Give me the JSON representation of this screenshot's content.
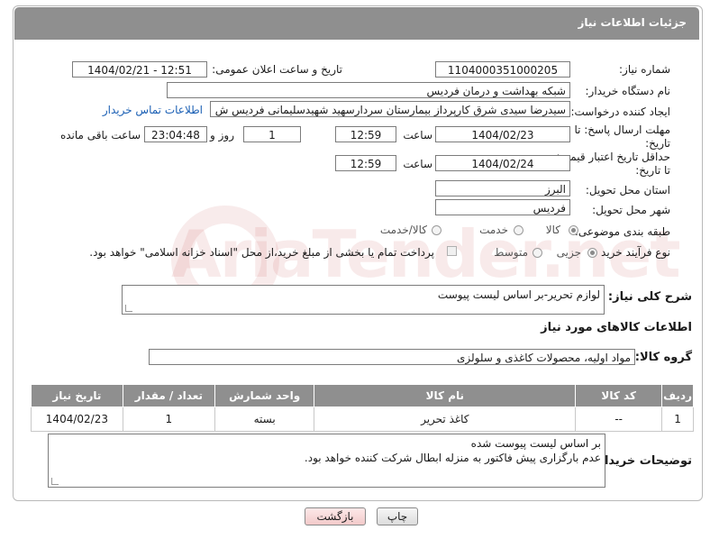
{
  "header": {
    "title": "جزئیات اطلاعات نیاز"
  },
  "form": {
    "need_number_label": "شماره نیاز:",
    "need_number": "1104000351000205",
    "announce_label": "تاریخ و ساعت اعلان عمومی:",
    "announce_value": "1404/02/21 - 12:51",
    "buyer_org_label": "نام دستگاه خریدار:",
    "buyer_org": "شبکه بهداشت و درمان فردیس",
    "creator_label": "ایجاد کننده درخواست:",
    "creator": "سیدرضا سیدی شرق کارپرداز بیمارستان سردارسهید شهیدسلیمانی فردیس ش",
    "contact_link": "اطلاعات تماس خریدار",
    "reply_deadline_label_1": "مهلت ارسال پاسخ: تا",
    "reply_deadline_label_2": "تاریخ:",
    "reply_date": "1404/02/23",
    "time_label": "ساعت",
    "reply_time": "12:59",
    "days_value": "1",
    "days_label": "روز و",
    "remaining_time": "23:04:48",
    "remaining_label": "ساعت باقی مانده",
    "price_deadline_label_1": "حداقل تاریخ اعتبار قیمت:",
    "price_deadline_label_2": "تا تاریخ:",
    "price_date": "1404/02/24",
    "price_time": "12:59",
    "province_label": "استان محل تحویل:",
    "province": "البرز",
    "city_label": "شهر محل تحویل:",
    "city": "فردیس",
    "category_label": "طبقه بندی موضوعی:",
    "category_options": [
      "کالا",
      "خدمت",
      "کالا/خدمت"
    ],
    "process_label": "نوع فرآیند خرید :",
    "process_options": [
      "جزیی",
      "متوسط"
    ],
    "payment_note": "پرداخت تمام یا بخشی از مبلغ خرید،از محل \"اسناد خزانه اسلامی\" خواهد بود."
  },
  "summary": {
    "label": "شرح کلی نیاز:",
    "value": "لوازم تحریر-بر اساس لیست پیوست"
  },
  "goods": {
    "section_title": "اطلاعات کالاهای مورد نیاز",
    "group_label": "گروه کالا:",
    "group_value": "مواد اولیه، محصولات کاغذی و سلولزی",
    "columns": [
      "ردیف",
      "کد کالا",
      "نام کالا",
      "واحد شمارش",
      "تعداد / مقدار",
      "تاریخ نیاز"
    ],
    "rows": [
      {
        "index": "1",
        "code": "--",
        "name": "کاغذ تحریر",
        "unit": "بسته",
        "qty": "1",
        "date": "1404/02/23"
      }
    ]
  },
  "buyer_notes": {
    "label": "توضیحات خریدار:",
    "line1": "بر اساس لیست پیوست شده",
    "line2": "عدم بارگزاری پیش فاکتور به منزله ابطال شرکت کننده خواهد بود."
  },
  "buttons": {
    "print": "چاپ",
    "back": "بازگشت"
  },
  "watermark": "AriaTender.net"
}
